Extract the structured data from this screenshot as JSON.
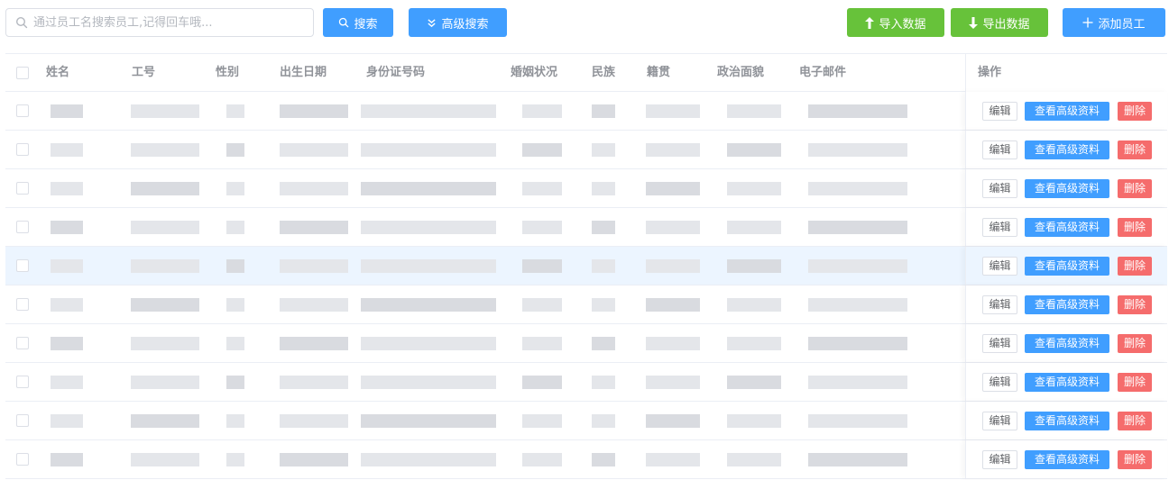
{
  "toolbar": {
    "search_placeholder": "通过员工名搜索员工,记得回车哦...",
    "search_button": "搜索",
    "advanced_search_button": "高级搜索",
    "import_button": "导入数据",
    "export_button": "导出数据",
    "add_button": "添加员工"
  },
  "table": {
    "columns": [
      "姓名",
      "工号",
      "性别",
      "出生日期",
      "身份证号码",
      "婚姻状况",
      "民族",
      "籍贯",
      "政治面貌",
      "电子邮件",
      "操作"
    ],
    "row_count": 10,
    "highlighted_row": 5,
    "actions": {
      "edit": "编辑",
      "view": "查看高级资料",
      "delete": "删除"
    }
  },
  "colors": {
    "primary": "#409eff",
    "success": "#67c23a",
    "danger": "#f56c6c",
    "row_highlight": "#ecf5ff"
  }
}
